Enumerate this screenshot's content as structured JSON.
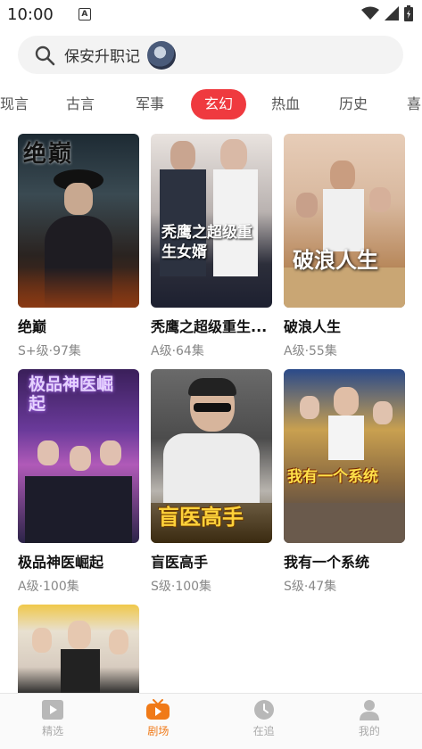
{
  "status_bar": {
    "time": "10:00",
    "indicator": "A"
  },
  "search": {
    "text": "保安升职记"
  },
  "tabs": [
    {
      "label": "现言"
    },
    {
      "label": "古言"
    },
    {
      "label": "军事"
    },
    {
      "label": "玄幻",
      "active": true
    },
    {
      "label": "热血"
    },
    {
      "label": "历史"
    },
    {
      "label": "喜"
    }
  ],
  "dramas": [
    {
      "title": "绝巅",
      "meta": "S+级·97集",
      "poster_text": "绝巅"
    },
    {
      "title": "秃鹰之超级重生...",
      "meta": "A级·64集",
      "poster_text": "秃鹰之超级重生女婿"
    },
    {
      "title": "破浪人生",
      "meta": "A级·55集",
      "poster_text": "破浪人生"
    },
    {
      "title": "极品神医崛起",
      "meta": "A级·100集",
      "poster_text": "极品神医崛起"
    },
    {
      "title": "盲医高手",
      "meta": "S级·100集",
      "poster_text": "盲医高手"
    },
    {
      "title": "我有一个系统",
      "meta": "S级·47集",
      "poster_text": "我有一个系统"
    }
  ],
  "bottom_nav": [
    {
      "label": "精选",
      "icon": "play-square-icon"
    },
    {
      "label": "剧场",
      "icon": "tv-icon",
      "active": true
    },
    {
      "label": "在追",
      "icon": "clock-icon"
    },
    {
      "label": "我的",
      "icon": "person-icon"
    }
  ],
  "colors": {
    "accent_red": "#ef3a3f",
    "nav_active": "#f07a18"
  }
}
